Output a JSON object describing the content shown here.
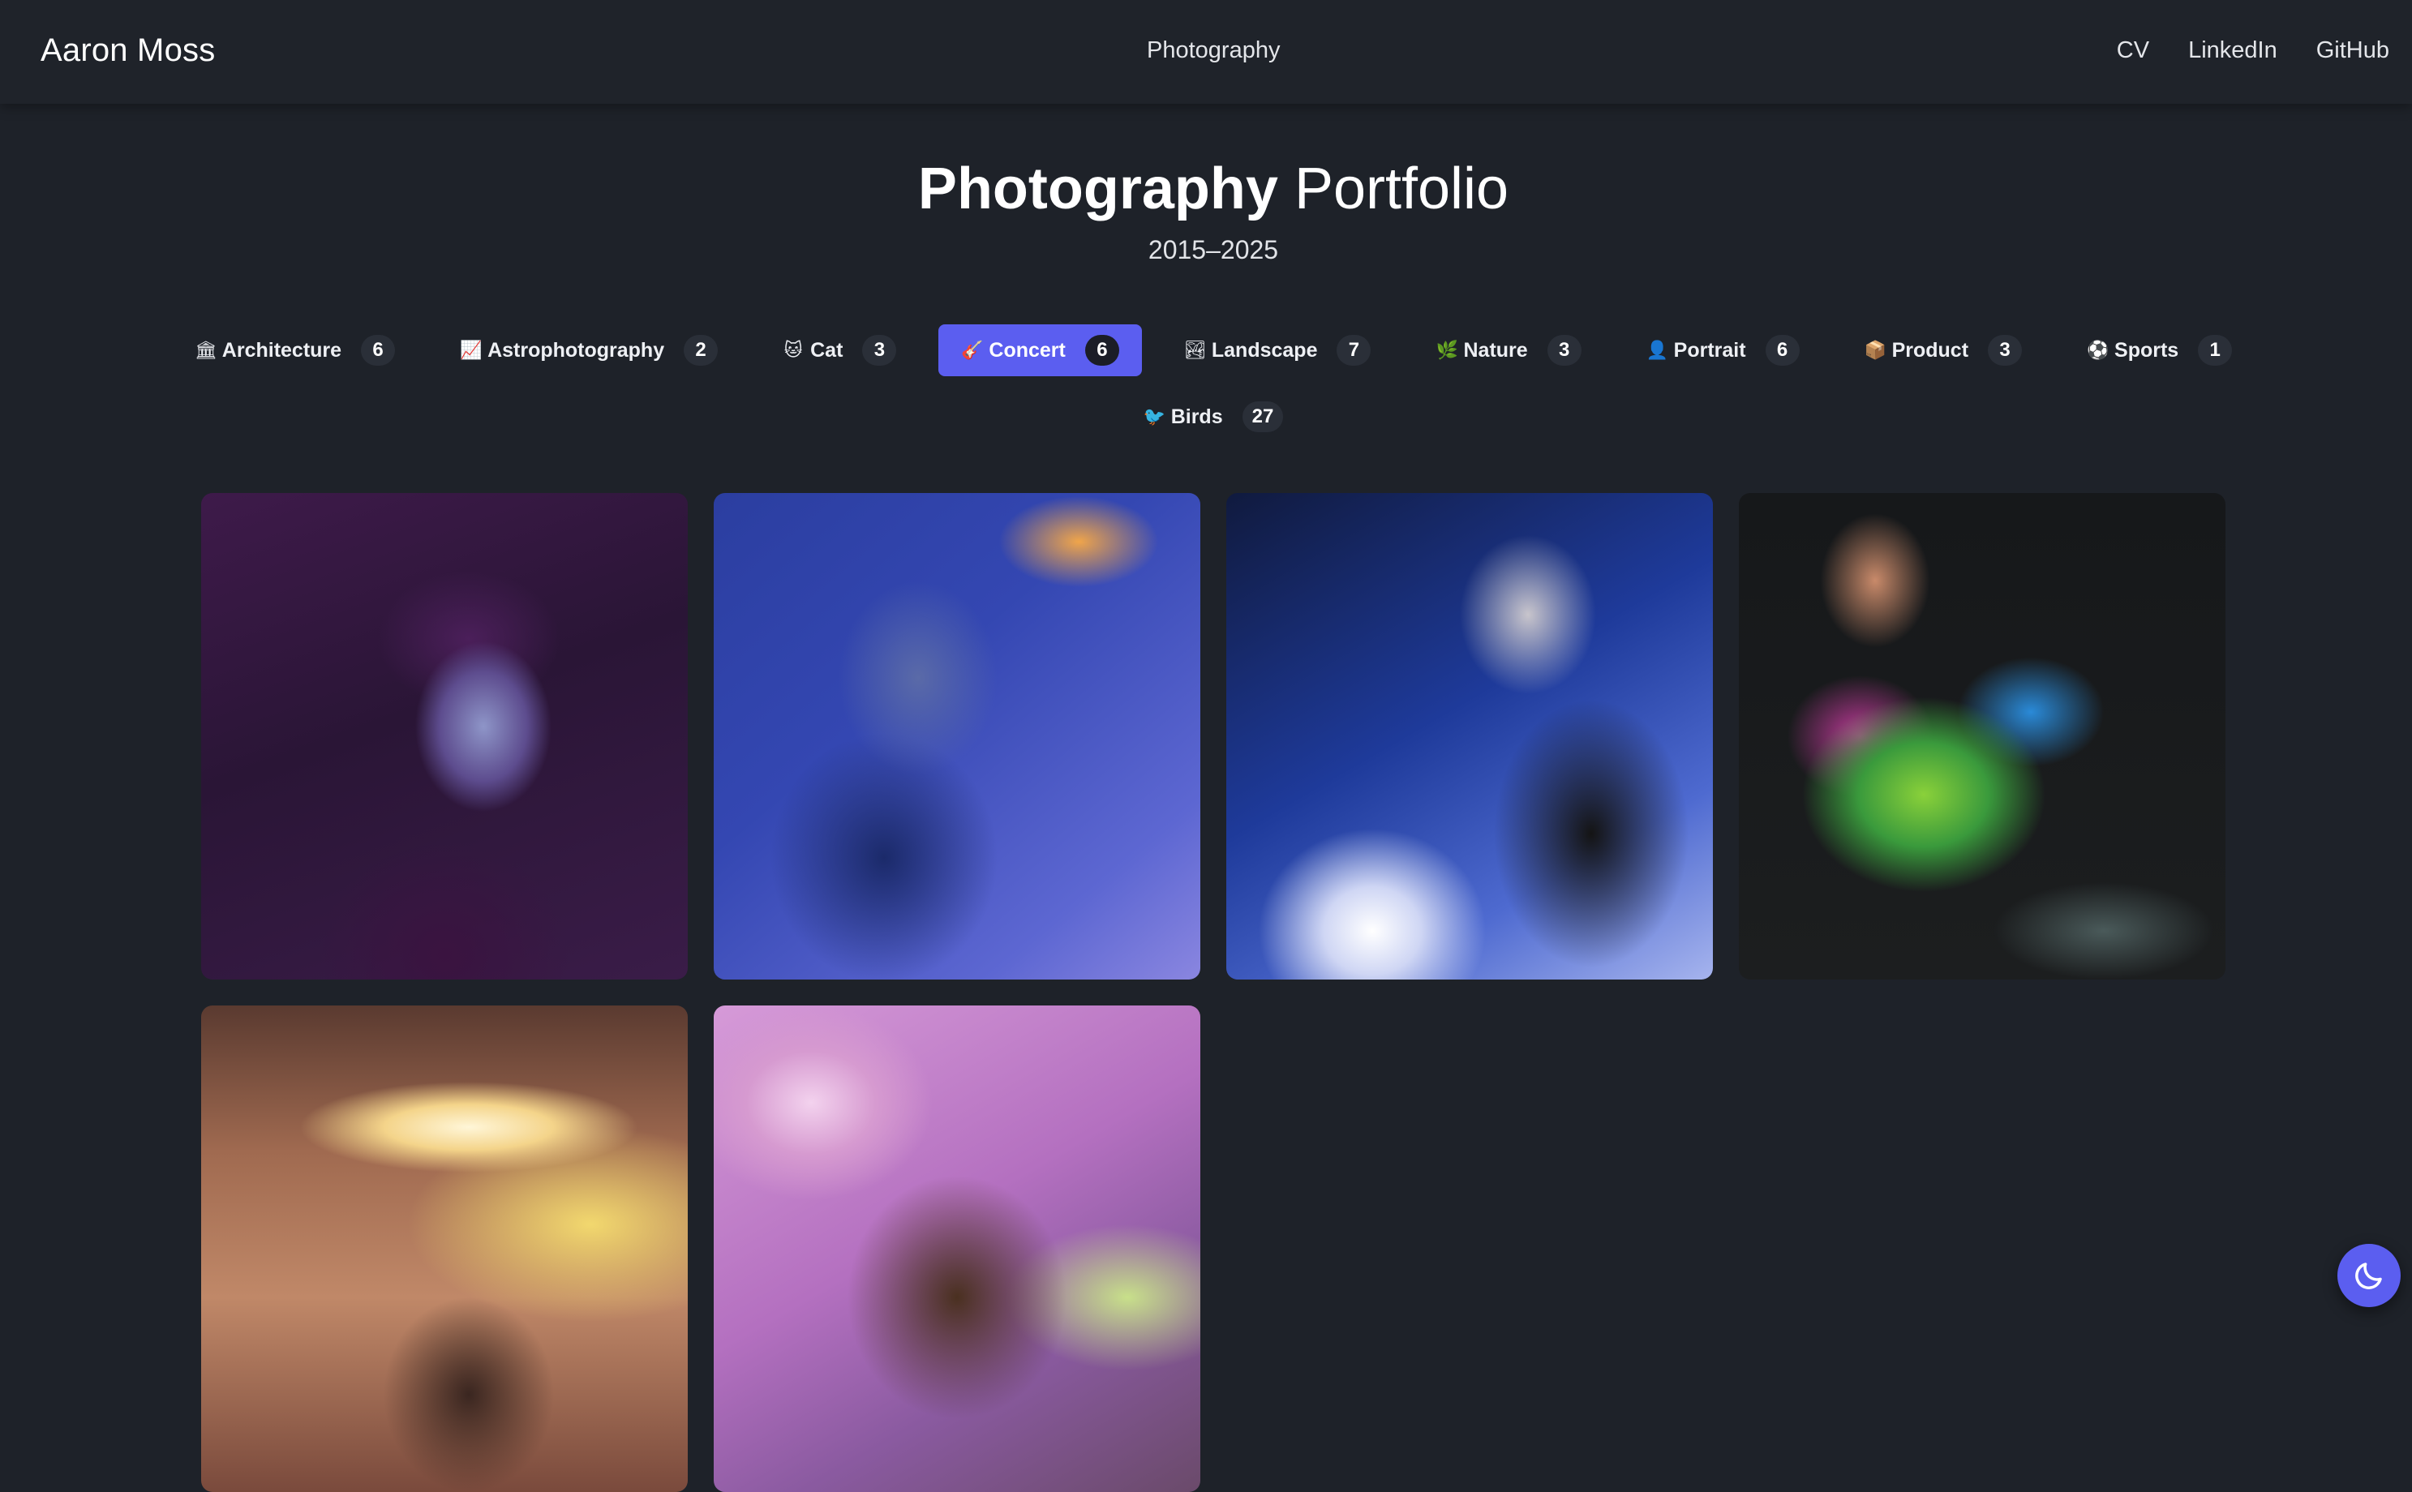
{
  "header": {
    "brand": "Aaron Moss",
    "center_link": "Photography",
    "links": [
      "CV",
      "LinkedIn",
      "GitHub"
    ]
  },
  "hero": {
    "title_strong": "Photography",
    "title_light": "Portfolio",
    "years": "2015–2025"
  },
  "filters": [
    {
      "icon": "classical-building-icon",
      "emoji": "🏛",
      "label": "Architecture",
      "count": "6",
      "active": false
    },
    {
      "icon": "chart-icon",
      "emoji": "📈",
      "label": "Astrophotography",
      "count": "2",
      "active": false
    },
    {
      "icon": "cat-face-icon",
      "emoji": "🐱",
      "label": "Cat",
      "count": "3",
      "active": false
    },
    {
      "icon": "guitar-icon",
      "emoji": "🎸",
      "label": "Concert",
      "count": "6",
      "active": true
    },
    {
      "icon": "landscape-icon",
      "emoji": "🏞",
      "label": "Landscape",
      "count": "7",
      "active": false
    },
    {
      "icon": "herb-icon",
      "emoji": "🌿",
      "label": "Nature",
      "count": "3",
      "active": false
    },
    {
      "icon": "person-icon",
      "emoji": "👤",
      "label": "Portrait",
      "count": "6",
      "active": false
    },
    {
      "icon": "package-icon",
      "emoji": "📦",
      "label": "Product",
      "count": "3",
      "active": false
    },
    {
      "icon": "soccer-ball-icon",
      "emoji": "⚽",
      "label": "Sports",
      "count": "1",
      "active": false
    },
    {
      "icon": "bird-icon",
      "emoji": "🐦",
      "label": "Birds",
      "count": "27",
      "active": false
    }
  ],
  "gallery": {
    "photos": [
      "concert-photo-1",
      "concert-photo-2",
      "concert-photo-3",
      "concert-photo-4",
      "concert-photo-5",
      "concert-photo-6"
    ]
  },
  "colors": {
    "background": "#1e2229",
    "accent": "#5b5ef0"
  }
}
